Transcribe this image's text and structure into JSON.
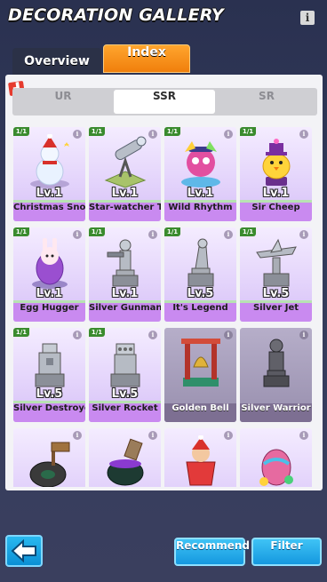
{
  "header": {
    "title": "DECORATION GALLERY",
    "info_icon": "info-icon"
  },
  "tabs": [
    {
      "label": "Overview",
      "active": false
    },
    {
      "label": "Index",
      "active": true
    }
  ],
  "new_badge_icon": "new-badge-icon",
  "rarity_filter": [
    {
      "label": "UR",
      "active": false
    },
    {
      "label": "SSR",
      "active": true
    },
    {
      "label": "SR",
      "active": false
    }
  ],
  "items": [
    {
      "name": "Christmas Snowm",
      "level": "Lv.1",
      "count": "1/1",
      "owned": true,
      "icon": "snowman-icon"
    },
    {
      "name": "Star-watcher Tel",
      "level": "Lv.1",
      "count": "1/1",
      "owned": true,
      "icon": "telescope-icon"
    },
    {
      "name": "Wild Rhythm",
      "level": "Lv.1",
      "count": "1/1",
      "owned": true,
      "icon": "wild-rhythm-icon"
    },
    {
      "name": "Sir Cheep",
      "level": "Lv.1",
      "count": "1/1",
      "owned": true,
      "icon": "chick-icon"
    },
    {
      "name": "Egg Hugger",
      "level": "Lv.1",
      "count": "1/1",
      "owned": true,
      "icon": "bunny-egg-icon"
    },
    {
      "name": "Silver Gunman",
      "level": "Lv.1",
      "count": "1/1",
      "owned": true,
      "icon": "gunman-statue-icon"
    },
    {
      "name": "It's Legend",
      "level": "Lv.5",
      "count": "1/1",
      "owned": true,
      "icon": "legend-statue-icon"
    },
    {
      "name": "Silver Jet",
      "level": "Lv.5",
      "count": "1/1",
      "owned": true,
      "icon": "jet-statue-icon"
    },
    {
      "name": "Silver Destroyer",
      "level": "Lv.5",
      "count": "1/1",
      "owned": true,
      "icon": "destroyer-statue-icon"
    },
    {
      "name": "Silver Rocket",
      "level": "Lv.5",
      "count": "1/1",
      "owned": true,
      "icon": "rocket-statue-icon"
    },
    {
      "name": "Golden Bell",
      "level": "",
      "count": "",
      "owned": false,
      "icon": "golden-bell-icon"
    },
    {
      "name": "Silver Warrior",
      "level": "",
      "count": "",
      "owned": false,
      "icon": "warrior-statue-icon"
    },
    {
      "name": "",
      "level": "",
      "count": "",
      "owned": false,
      "icon": "tire-sign-icon"
    },
    {
      "name": "",
      "level": "",
      "count": "",
      "owned": false,
      "icon": "cauldron-icon"
    },
    {
      "name": "",
      "level": "",
      "count": "",
      "owned": false,
      "icon": "santa-cup-icon"
    },
    {
      "name": "",
      "level": "",
      "count": "",
      "owned": false,
      "icon": "fancy-egg-icon"
    }
  ],
  "bottom": {
    "back_icon": "back-arrow-icon",
    "recommend_label": "Recommend",
    "filter_label": "Filter"
  }
}
